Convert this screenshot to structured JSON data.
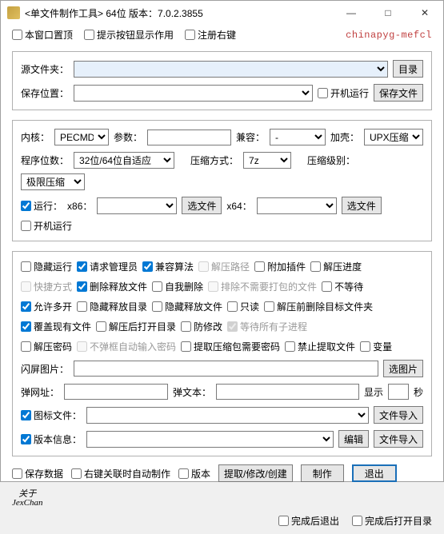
{
  "title": "<单文件制作工具> 64位 版本：7.0.2.3855",
  "watermark": "chinapyg-mefcl",
  "top_checks": {
    "pin": "本窗口置顶",
    "hint": "提示按钮显示作用",
    "reg_right": "注册右键"
  },
  "g1": {
    "src_label": "源文件夹：",
    "dir_btn": "目录",
    "save_label": "保存位置：",
    "boot_run": "开机运行",
    "save_btn": "保存文件"
  },
  "g2": {
    "kernel_label": "内核：",
    "kernel_value": "PECMD",
    "params_label": "参数：",
    "compat_label": "兼容：",
    "compat_value": "-",
    "shell_label": "加壳：",
    "shell_value": "UPX压缩",
    "bits_label": "程序位数：",
    "bits_value": "32位/64位自适应",
    "zipmode_label": "压缩方式：",
    "zipmode_value": "7z",
    "ziplevel_label": "压缩级别：",
    "ziplevel_value": "极限压缩",
    "run_check": "运行：",
    "x86": "x86：",
    "pick1": "选文件",
    "x64": "x64：",
    "pick2": "选文件",
    "boot_run2": "开机运行"
  },
  "g3": {
    "hide_run": "隐藏运行",
    "req_admin": "请求管理员",
    "compat_algo": "兼容算法",
    "unzip_path": "解压路径",
    "attach_plugin": "附加插件",
    "unzip_progress": "解压进度",
    "shortcut": "快捷方式",
    "del_release": "删除释放文件",
    "self_del": "自我删除",
    "exclude_files": "排除不需要打包的文件",
    "no_wait": "不等待",
    "allow_multi": "允许多开",
    "hide_rel_dir": "隐藏释放目录",
    "hide_rel_file": "隐藏释放文件",
    "readonly": "只读",
    "del_before_unzip": "解压前删除目标文件夹",
    "overwrite": "覆盖现有文件",
    "open_after_unzip": "解压后打开目录",
    "anti_modify": "防修改",
    "wait_children": "等待所有子进程",
    "unzip_pwd": "解压密码",
    "no_auto_pwd": "不弹框自动输入密码",
    "pkg_need_pwd": "提取压缩包需要密码",
    "forbid_extract": "禁止提取文件",
    "variable": "变量",
    "splash_label": "闪屏图片：",
    "pick_img": "选图片",
    "popup_url_label": "弹网址：",
    "popup_text_label": "弹文本：",
    "show_label": "显示",
    "seconds": "秒",
    "icon_file_chk": "图标文件：",
    "file_import": "文件导入",
    "version_info_chk": "版本信息：",
    "edit": "编辑"
  },
  "bottom": {
    "save_data": "保存数据",
    "auto_on_assoc": "右键关联时自动制作",
    "version": "版本",
    "extract": "提取/修改/创建",
    "make": "制作",
    "exit": "退出",
    "about1": "关于",
    "about2": "JexChan",
    "exit_after": "完成后退出",
    "open_after": "完成后打开目录"
  }
}
